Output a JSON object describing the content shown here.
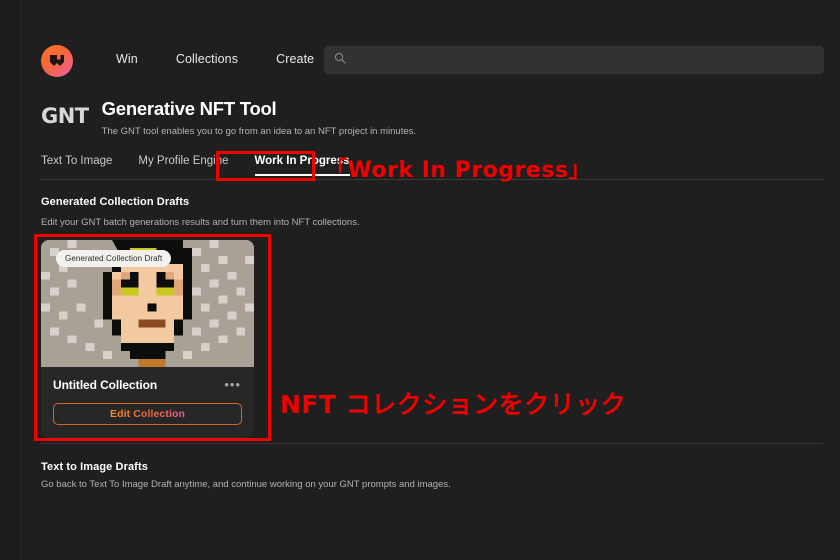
{
  "brand": {
    "logo_icon": "m-monogram-logo",
    "accent_orange": "#f59323",
    "accent_pink": "#ee5f92",
    "annotation_red": "#f10000"
  },
  "nav": {
    "items": [
      {
        "label": "Win"
      },
      {
        "label": "Collections"
      },
      {
        "label": "Create"
      }
    ]
  },
  "search": {
    "icon": "search-icon",
    "value": "",
    "placeholder": ""
  },
  "header": {
    "product_logo": "GNT",
    "title": "Generative NFT Tool",
    "subtitle": "The GNT tool enables you to go from an idea to an NFT project in minutes."
  },
  "tabs": [
    {
      "label": "Text To Image",
      "active": false
    },
    {
      "label": "My Profile Engine",
      "active": false
    },
    {
      "label": "Work In Progress",
      "active": true
    }
  ],
  "sections": {
    "generated_drafts": {
      "title": "Generated Collection Drafts",
      "subtitle": "Edit your GNT batch generations results and turn them into NFT collections."
    },
    "text_to_image_drafts": {
      "title": "Text to Image Drafts",
      "subtitle": "Go back to Text To Image Draft anytime, and continue working on your GNT prompts and images."
    }
  },
  "card": {
    "badge": "Generated Collection Draft",
    "name": "Untitled Collection",
    "menu_icon": "more-options-icon",
    "button_label": "Edit Collection",
    "artwork": "pixel-art-avatar"
  },
  "annotations": {
    "tab_callout": "「Work In Progress」",
    "card_callout": "NFT コレクションをクリック"
  }
}
